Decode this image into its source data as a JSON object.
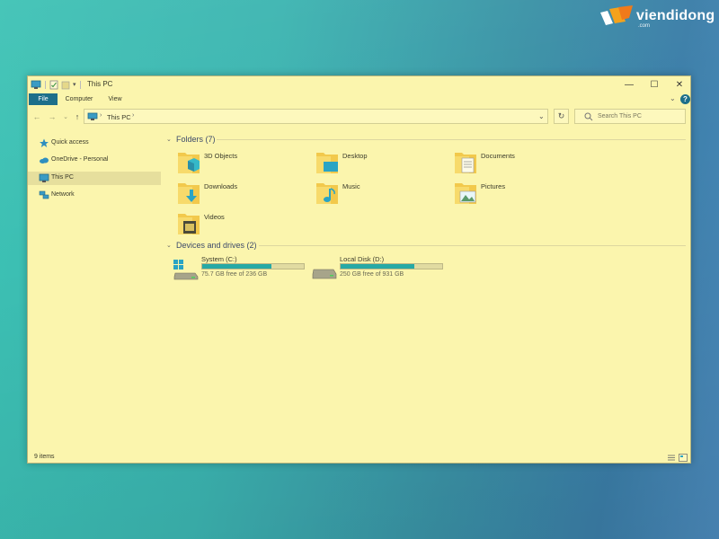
{
  "watermark": {
    "brand": "viendidong",
    "sub": ".com"
  },
  "window": {
    "title": "This PC",
    "controls": {
      "minimize": "—",
      "maximize": "☐",
      "close": "✕"
    }
  },
  "ribbon": {
    "tabs": [
      {
        "label": "File",
        "active": true
      },
      {
        "label": "Computer"
      },
      {
        "label": "View"
      }
    ]
  },
  "address": {
    "path": [
      "This PC"
    ],
    "search_placeholder": "Search This PC"
  },
  "nav_pane": {
    "items": [
      {
        "label": "Quick access",
        "icon": "star-icon"
      },
      {
        "label": "OneDrive - Personal",
        "icon": "cloud-icon"
      },
      {
        "label": "This PC",
        "icon": "computer-icon",
        "selected": true
      },
      {
        "label": "Network",
        "icon": "network-icon"
      }
    ]
  },
  "folders": {
    "header": "Folders (7)",
    "items": [
      {
        "label": "3D Objects",
        "icon": "3d-objects-folder-icon"
      },
      {
        "label": "Desktop",
        "icon": "desktop-folder-icon"
      },
      {
        "label": "Documents",
        "icon": "documents-folder-icon"
      },
      {
        "label": "Downloads",
        "icon": "downloads-folder-icon"
      },
      {
        "label": "Music",
        "icon": "music-folder-icon"
      },
      {
        "label": "Pictures",
        "icon": "pictures-folder-icon"
      },
      {
        "label": "Videos",
        "icon": "videos-folder-icon"
      }
    ]
  },
  "drives": {
    "header": "Devices and drives (2)",
    "items": [
      {
        "label": "System (C:)",
        "free_text": "75.7 GB free of 236 GB",
        "used_fraction": 0.68,
        "icon": "windows-drive-icon"
      },
      {
        "label": "Local Disk (D:)",
        "free_text": "250 GB free of 931 GB",
        "used_fraction": 0.73,
        "icon": "drive-icon"
      }
    ]
  },
  "status": {
    "item_count": "9 items"
  },
  "colors": {
    "window_bg": "#fbf5ad",
    "accent": "#1d6f8a",
    "drive_fill": "#27a9a5",
    "folder": "#f2c94c"
  }
}
